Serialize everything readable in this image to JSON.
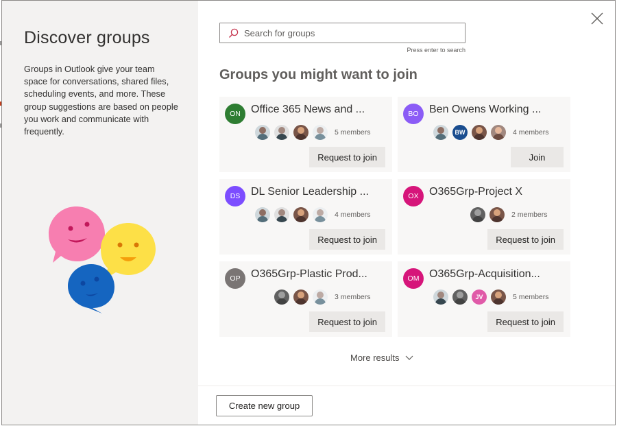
{
  "dialog": {
    "title": "Discover groups",
    "description": "Groups in Outlook give your team space for conversations, shared files, scheduling events, and more. These group suggestions are based on people you work and communicate with frequently."
  },
  "search": {
    "placeholder": "Search for groups",
    "value": "",
    "hint": "Press enter to search"
  },
  "section_title": "Groups you might want to join",
  "groups": [
    {
      "initials": "ON",
      "name": "Office 365 News and ...",
      "color": "#2e7d32",
      "member_count": "5 members",
      "action": "Request to join"
    },
    {
      "initials": "BO",
      "name": "Ben Owens Working ...",
      "color": "#8b5cf6",
      "member_count": "4 members",
      "action": "Join"
    },
    {
      "initials": "DS",
      "name": "DL Senior Leadership ...",
      "color": "#7c4dff",
      "member_count": "4 members",
      "action": "Request to join"
    },
    {
      "initials": "OX",
      "name": "O365Grp-Project X",
      "color": "#d6157a",
      "member_count": "2 members",
      "action": "Request to join"
    },
    {
      "initials": "OP",
      "name": "O365Grp-Plastic Prod...",
      "color": "#7a7574",
      "member_count": "3 members",
      "action": "Request to join"
    },
    {
      "initials": "OM",
      "name": "O365Grp-Acquisition...",
      "color": "#d6157a",
      "member_count": "5 members",
      "action": "Request to join"
    }
  ],
  "member_initials": {
    "bw": "BW",
    "jv": "JV"
  },
  "more_results": "More results",
  "create_button": "Create new group"
}
